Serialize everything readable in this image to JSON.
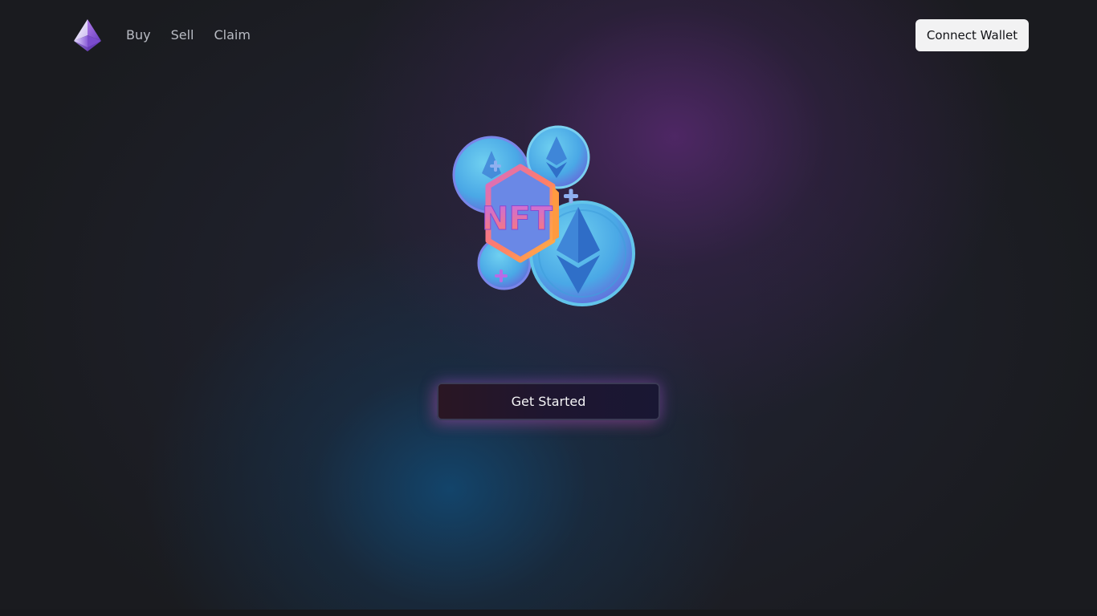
{
  "navbar": {
    "logo_icon": "ethereum-diamond-logo-icon",
    "links": [
      {
        "label": "Buy"
      },
      {
        "label": "Sell"
      },
      {
        "label": "Claim"
      }
    ],
    "connect_label": "Connect Wallet"
  },
  "hero": {
    "illustration_text": "NFT",
    "illustration_icon": "nft-ethereum-coins-illustration",
    "cta_label": "Get Started"
  },
  "colors": {
    "background": "#1a1b1f",
    "purple_glow": "#56286e",
    "blue_glow": "#12466e",
    "connect_button_bg": "#f2f2f3",
    "nav_text": "#b9bcc4"
  }
}
